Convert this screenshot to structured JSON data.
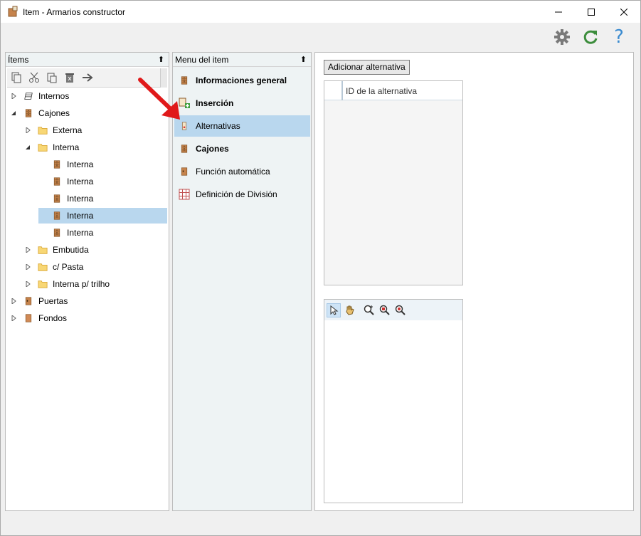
{
  "window": {
    "title": "Item - Armarios constructor"
  },
  "colors": {
    "accent_selected": "#b9d7ee",
    "refresh_green": "#3c8d3c",
    "help_blue": "#3b8bd0",
    "arrow_red": "#e0191a"
  },
  "toolbar": {
    "icons": [
      "gear-icon",
      "refresh-icon",
      "help-icon"
    ],
    "help_glyph": "?"
  },
  "items_panel": {
    "title": "Ítems",
    "tools": [
      "copy-icon",
      "cut-icon",
      "paste-icon",
      "delete-icon",
      "arrow-right-icon"
    ],
    "tree": [
      {
        "label": "Internos",
        "icon": "drawer-stack-icon",
        "expanded": false,
        "level": 0
      },
      {
        "label": "Cajones",
        "icon": "cabinet-icon",
        "expanded": true,
        "level": 0
      },
      {
        "label": "Externa",
        "icon": "folder-icon",
        "expanded": false,
        "level": 1
      },
      {
        "label": "Interna",
        "icon": "folder-icon",
        "expanded": true,
        "level": 1
      },
      {
        "label": "Interna",
        "icon": "cabinet-icon",
        "level": 2
      },
      {
        "label": "Interna",
        "icon": "cabinet-icon",
        "level": 2
      },
      {
        "label": "Interna",
        "icon": "cabinet-icon",
        "level": 2
      },
      {
        "label": "Interna",
        "icon": "cabinet-icon",
        "level": 2,
        "selected": true
      },
      {
        "label": "Interna",
        "icon": "cabinet-icon",
        "level": 2
      },
      {
        "label": "Embutida",
        "icon": "folder-icon",
        "expanded": false,
        "level": 1
      },
      {
        "label": "c/ Pasta",
        "icon": "folder-icon",
        "expanded": false,
        "level": 1
      },
      {
        "label": "Interna p/ trilho",
        "icon": "folder-icon",
        "expanded": false,
        "level": 1
      },
      {
        "label": "Puertas",
        "icon": "door-icon",
        "expanded": false,
        "level": 0
      },
      {
        "label": "Fondos",
        "icon": "panel-icon",
        "expanded": false,
        "level": 0
      }
    ]
  },
  "menu_panel": {
    "title": "Menu del item",
    "items": [
      {
        "label": "Informaciones general",
        "icon": "cabinet-icon",
        "bold": true
      },
      {
        "label": "Inserción",
        "icon": "insert-icon",
        "bold": true
      },
      {
        "label": "Alternativas",
        "icon": "alternatives-icon",
        "bold": false,
        "selected": true
      },
      {
        "label": "Cajones",
        "icon": "cabinet-icon",
        "bold": true
      },
      {
        "label": "Función automática",
        "icon": "door-icon",
        "bold": false
      },
      {
        "label": "Definición de División",
        "icon": "grid-icon",
        "bold": false
      }
    ]
  },
  "main_panel": {
    "add_button": "Adicionar alternativa",
    "grid_column": "ID de la alternativa",
    "preview_tools": [
      "pointer-icon",
      "hand-icon",
      "zoom-in-icon",
      "zoom-fit-icon",
      "zoom-out-icon"
    ]
  }
}
